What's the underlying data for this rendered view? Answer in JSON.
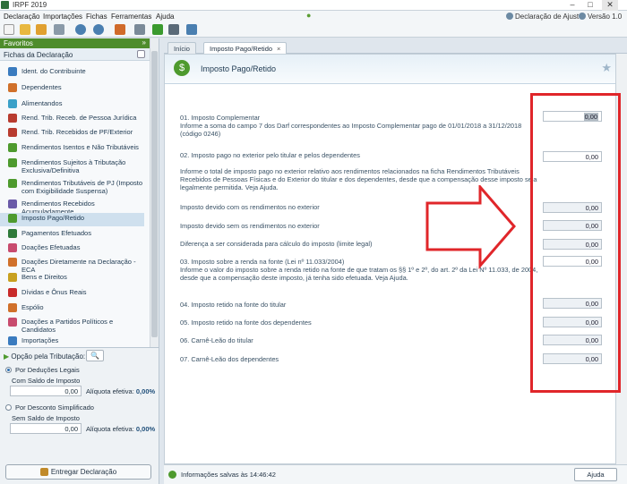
{
  "window": {
    "title": "IRPF 2019",
    "minimize": "–",
    "maximize": "□",
    "close": "✕"
  },
  "menubar": {
    "items": [
      "Declaração",
      "Importações",
      "Fichas",
      "Ferramentas",
      "Ajuda"
    ],
    "help": "Declaração de Ajuste",
    "version": "Versão 1.0"
  },
  "sidebar": {
    "favoritos": "Favoritos",
    "fichas_header": "Fichas da Declaração",
    "items": [
      {
        "label": "Ident. do Contribuinte",
        "color": "#3a7bbf"
      },
      {
        "label": "Dependentes",
        "color": "#d0702a"
      },
      {
        "label": "Alimentandos",
        "color": "#3aa0c8"
      },
      {
        "label": "Rend. Trib. Receb. de Pessoa Jurídica",
        "color": "#b83b2f"
      },
      {
        "label": "Rend. Trib. Recebidos de PF/Exterior",
        "color": "#b83b2f"
      },
      {
        "label": "Rendimentos Isentos e Não Tributáveis",
        "color": "#4e9a2e"
      },
      {
        "label": "Rendimentos Sujeitos à Tributação Exclusiva/Definitiva",
        "color": "#4e9a2e"
      },
      {
        "label": "Rendimentos Tributáveis de PJ (Imposto com Exigibilidade Suspensa)",
        "color": "#4e9a2e"
      },
      {
        "label": "Rendimentos Recebidos Acumuladamente",
        "color": "#6a5aa8"
      },
      {
        "label": "Imposto Pago/Retido",
        "color": "#4e9a2e"
      },
      {
        "label": "Pagamentos Efetuados",
        "color": "#2f7a3a"
      },
      {
        "label": "Doações Efetuadas",
        "color": "#c84b6e"
      },
      {
        "label": "Doações Diretamente na Declaração - ECA",
        "color": "#d0702a"
      },
      {
        "label": "Bens e Direitos",
        "color": "#c8a020"
      },
      {
        "label": "Dívidas e Ônus Reais",
        "color": "#c82a2a"
      },
      {
        "label": "Espólio",
        "color": "#d0702a"
      },
      {
        "label": "Doações a Partidos Políticos e Candidatos",
        "color": "#c84b6e"
      },
      {
        "label": "Importações",
        "color": "#3a7bbf"
      }
    ],
    "selected_index": 9,
    "option_header": "Opção pela Tributação:",
    "option_search": "🔍",
    "opt1": {
      "label": "Por Deduções Legais",
      "sub": "Com Saldo de Imposto",
      "value": "0,00",
      "aliquota_label": "Alíquota efetiva:",
      "aliquota": "0,00%"
    },
    "opt2": {
      "label": "Por Desconto Simplificado",
      "sub": "Sem Saldo de Imposto",
      "value": "0,00",
      "aliquota_label": "Alíquota efetiva:",
      "aliquota": "0,00%"
    },
    "entregar": "Entregar Declaração"
  },
  "tabs": [
    {
      "label": "Início"
    },
    {
      "label": "Imposto Pago/Retido",
      "close": "×"
    }
  ],
  "section": {
    "title": "Imposto Pago/Retido",
    "icon": "$"
  },
  "rows": [
    {
      "text": "01. Imposto Complementar\nInforme a soma do campo 7 dos Darf correspondentes ao Imposto Complementar pago de 01/01/2018 a 31/12/2018 (código 0246)",
      "value": "0,00",
      "editable": true
    },
    {
      "text": "02. Imposto pago no exterior pelo titular e pelos dependentes\n\nInforme o total de imposto pago no exterior relativo aos rendimentos relacionados na ficha Rendimentos Tributáveis Recebidos de Pessoas Físicas e do Exterior do titular e dos dependentes, desde que a compensação desse imposto seja legalmente permitida. Veja Ajuda.",
      "value": "0,00",
      "editable": true
    },
    {
      "text": "Imposto devido com os rendimentos no exterior",
      "value": "0,00",
      "editable": false
    },
    {
      "text": "Imposto devido sem os rendimentos no exterior",
      "value": "0,00",
      "editable": false
    },
    {
      "text": "Diferença a ser considerada para cálculo do imposto (limite legal)",
      "value": "0,00",
      "editable": false
    },
    {
      "text": "03. Imposto sobre a renda na fonte (Lei nº 11.033/2004)\nInforme o valor do imposto sobre a renda retido na fonte de que tratam os §§ 1º e 2º, do art. 2º da Lei Nº 11.033, de 2004, desde que a compensação deste imposto, já tenha sido efetuada. Veja Ajuda.",
      "value": "0,00",
      "editable": true
    },
    {
      "text": "04. Imposto retido na fonte do titular",
      "value": "0,00",
      "editable": false
    },
    {
      "text": "05. Imposto retido na fonte dos dependentes",
      "value": "0,00",
      "editable": false
    },
    {
      "text": "06. Carnê-Leão do titular",
      "value": "0,00",
      "editable": false
    },
    {
      "text": "07. Carnê-Leão dos dependentes",
      "value": "0,00",
      "editable": false
    }
  ],
  "status": {
    "message": "Informações salvas às 14:46:42",
    "help_button": "Ajuda"
  },
  "colors": {
    "annotation_red": "#e0262a",
    "accent_green": "#4e9a2e"
  }
}
